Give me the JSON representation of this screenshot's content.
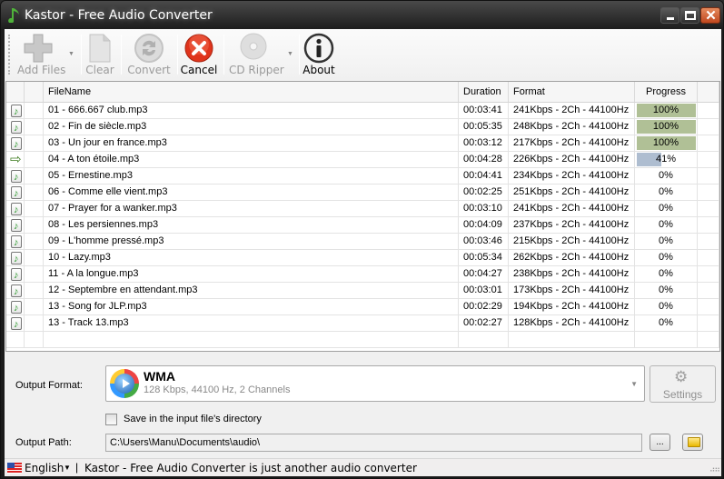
{
  "window": {
    "title": "Kastor - Free Audio Converter",
    "controls": {
      "minimize": "_",
      "maximize": "□",
      "close": "✕"
    }
  },
  "toolbar": {
    "buttons": [
      {
        "label": "Add Files",
        "icon": "plus-icon",
        "enabled": false,
        "has_dropdown": true
      },
      {
        "label": "Clear",
        "icon": "document-icon",
        "enabled": false
      },
      {
        "label": "Convert",
        "icon": "refresh-icon",
        "enabled": false
      },
      {
        "label": "Cancel",
        "icon": "cancel-icon",
        "enabled": true
      },
      {
        "label": "CD Ripper",
        "icon": "cd-icon",
        "enabled": false,
        "has_dropdown": true
      },
      {
        "label": "About",
        "icon": "info-icon",
        "enabled": true
      }
    ]
  },
  "file_list": {
    "columns": [
      "",
      "",
      "FileName",
      "Duration",
      "Format",
      "Progress"
    ],
    "rows": [
      {
        "status": "done",
        "name": "01 - 666.667 club.mp3",
        "duration": "00:03:41",
        "format": "241Kbps - 2Ch - 44100Hz",
        "progress": 100,
        "progress_label": "100%"
      },
      {
        "status": "done",
        "name": "02 - Fin de siècle.mp3",
        "duration": "00:05:35",
        "format": "248Kbps - 2Ch - 44100Hz",
        "progress": 100,
        "progress_label": "100%"
      },
      {
        "status": "done",
        "name": "03 - Un jour en france.mp3",
        "duration": "00:03:12",
        "format": "217Kbps - 2Ch - 44100Hz",
        "progress": 100,
        "progress_label": "100%"
      },
      {
        "status": "converting",
        "name": "04 - A ton étoile.mp3",
        "duration": "00:04:28",
        "format": "226Kbps - 2Ch - 44100Hz",
        "progress": 41,
        "progress_label": "41%"
      },
      {
        "status": "pending",
        "name": "05 - Ernestine.mp3",
        "duration": "00:04:41",
        "format": "234Kbps - 2Ch - 44100Hz",
        "progress": 0,
        "progress_label": "0%"
      },
      {
        "status": "pending",
        "name": "06 - Comme elle vient.mp3",
        "duration": "00:02:25",
        "format": "251Kbps - 2Ch - 44100Hz",
        "progress": 0,
        "progress_label": "0%"
      },
      {
        "status": "pending",
        "name": "07 - Prayer for a wanker.mp3",
        "duration": "00:03:10",
        "format": "241Kbps - 2Ch - 44100Hz",
        "progress": 0,
        "progress_label": "0%"
      },
      {
        "status": "pending",
        "name": "08 - Les persiennes.mp3",
        "duration": "00:04:09",
        "format": "237Kbps - 2Ch - 44100Hz",
        "progress": 0,
        "progress_label": "0%"
      },
      {
        "status": "pending",
        "name": "09 - L'homme pressé.mp3",
        "duration": "00:03:46",
        "format": "215Kbps - 2Ch - 44100Hz",
        "progress": 0,
        "progress_label": "0%"
      },
      {
        "status": "pending",
        "name": "10 - Lazy.mp3",
        "duration": "00:05:34",
        "format": "262Kbps - 2Ch - 44100Hz",
        "progress": 0,
        "progress_label": "0%"
      },
      {
        "status": "pending",
        "name": "11 - A la longue.mp3",
        "duration": "00:04:27",
        "format": "238Kbps - 2Ch - 44100Hz",
        "progress": 0,
        "progress_label": "0%"
      },
      {
        "status": "pending",
        "name": "12 - Septembre en attendant.mp3",
        "duration": "00:03:01",
        "format": "173Kbps - 2Ch - 44100Hz",
        "progress": 0,
        "progress_label": "0%"
      },
      {
        "status": "pending",
        "name": "13 - Song for JLP.mp3",
        "duration": "00:02:29",
        "format": "194Kbps - 2Ch - 44100Hz",
        "progress": 0,
        "progress_label": "0%"
      },
      {
        "status": "pending",
        "name": "13 - Track 13.mp3",
        "duration": "00:02:27",
        "format": "128Kbps - 2Ch - 44100Hz",
        "progress": 0,
        "progress_label": "0%"
      }
    ]
  },
  "colors": {
    "progress_done": "#b0c096",
    "progress_active": "#aebdd0"
  },
  "output": {
    "format_label": "Output Format:",
    "format_name": "WMA",
    "format_desc": "128 Kbps, 44100 Hz, 2 Channels",
    "settings_label": "Settings",
    "save_in_input_dir_label": "Save in the input file's directory",
    "save_in_input_dir_checked": false,
    "path_label": "Output Path:",
    "path_value": "C:\\Users\\Manu\\Documents\\audio\\",
    "browse_label": "..."
  },
  "statusbar": {
    "language": "English",
    "separator": "|",
    "message": "Kastor - Free Audio Converter is just another audio converter"
  }
}
